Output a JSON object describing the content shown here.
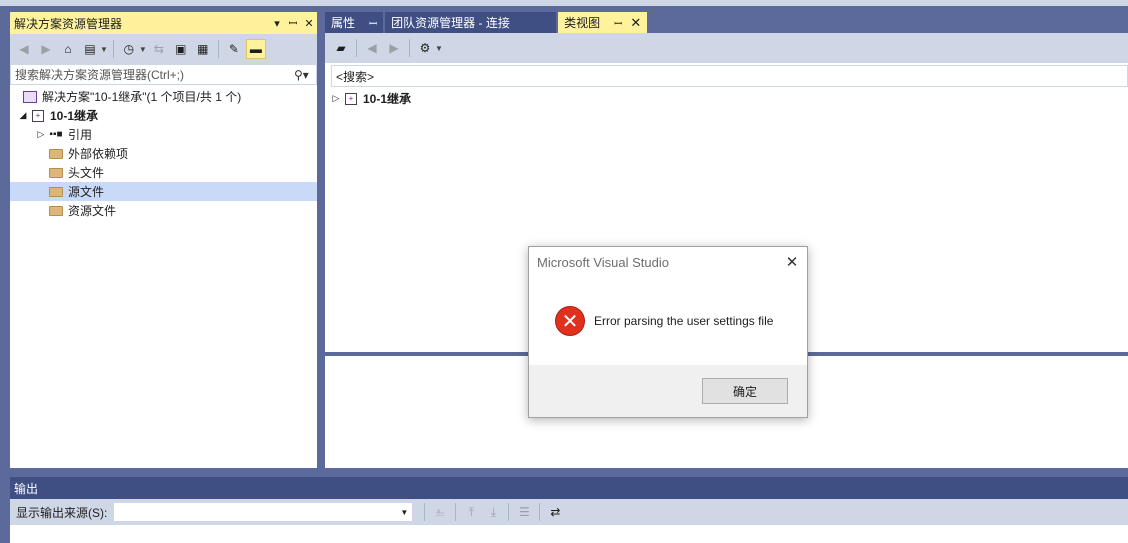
{
  "solution_explorer": {
    "title": "解决方案资源管理器",
    "title_buttons": [
      "▾",
      "ꟷ",
      "✕"
    ],
    "search_placeholder": "搜索解决方案资源管理器(Ctrl+;)",
    "tree": {
      "solution": "解决方案\"10-1继承\"(1 个项目/共 1 个)",
      "project": "10-1继承",
      "references": "引用",
      "external_deps": "外部依赖项",
      "header_files": "头文件",
      "source_files": "源文件",
      "resource_files": "资源文件"
    },
    "selected_item": "源文件"
  },
  "tabs": [
    {
      "label": "属性",
      "pin": "ꟷ"
    },
    {
      "label": "团队资源管理器 - 连接"
    },
    {
      "label": "类视图",
      "pin": "ꟷ",
      "close": "✕",
      "active": true
    }
  ],
  "class_view": {
    "search_text": "<搜索>",
    "root_node": "10-1继承"
  },
  "output": {
    "title": "输出",
    "source_label": "显示输出来源(S):",
    "source_value": ""
  },
  "dialog": {
    "title": "Microsoft Visual Studio",
    "message": "Error parsing the user settings file",
    "ok_label": "确定",
    "icon": "error-icon"
  },
  "colors": {
    "active_title": "#fff29d",
    "frame": "#5b6a9a",
    "toolbar": "#cfd6e5",
    "selection": "#c9daf8",
    "error": "#e0301e"
  }
}
